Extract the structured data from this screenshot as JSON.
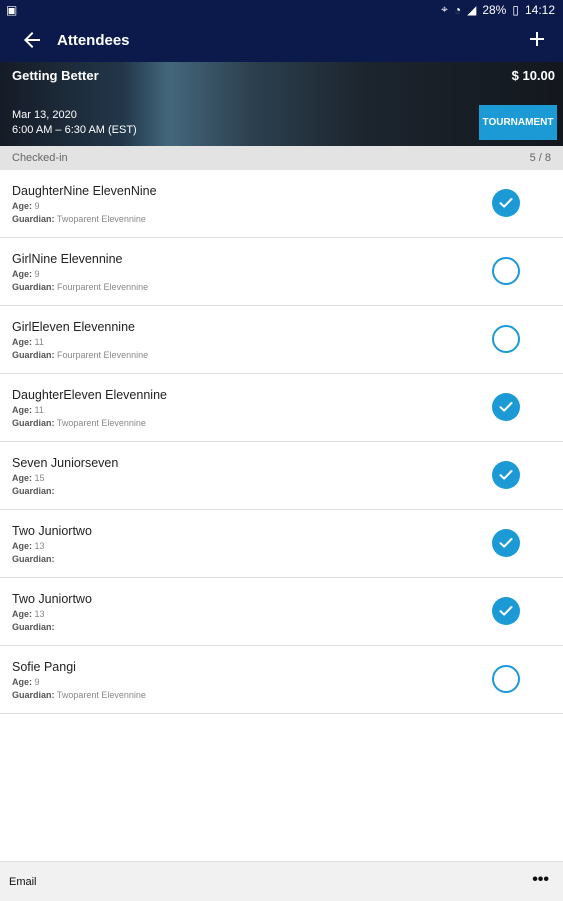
{
  "status_bar": {
    "time": "14:12",
    "battery": "28%"
  },
  "toolbar": {
    "title": "Attendees",
    "back_icon": "arrow-left-icon",
    "add_icon": "plus-icon"
  },
  "event": {
    "name": "Getting Better",
    "price": "$ 10.00",
    "date": "Mar 13, 2020",
    "time": "6:00 AM – 6:30 AM (EST)",
    "tag": "TOURNAMENT"
  },
  "section": {
    "label": "Checked-in",
    "count": "5 / 8"
  },
  "labels": {
    "age": "Age:",
    "guardian": "Guardian:"
  },
  "attendees": [
    {
      "name": "DaughterNine ElevenNine",
      "age": "9",
      "guardian": "Twoparent Elevennine",
      "checked": true
    },
    {
      "name": "GirlNine Elevennine",
      "age": "9",
      "guardian": "Fourparent Elevennine",
      "checked": false
    },
    {
      "name": "GirlEleven Elevennine",
      "age": "11",
      "guardian": "Fourparent Elevennine",
      "checked": false
    },
    {
      "name": "DaughterEleven Elevennine",
      "age": "11",
      "guardian": "Twoparent Elevennine",
      "checked": true
    },
    {
      "name": "Seven Juniorseven",
      "age": "15",
      "guardian": "",
      "checked": true
    },
    {
      "name": "Two Juniortwo",
      "age": "13",
      "guardian": "",
      "checked": true
    },
    {
      "name": "Two Juniortwo",
      "age": "13",
      "guardian": "",
      "checked": true
    },
    {
      "name": "Sofie Pangi",
      "age": "9",
      "guardian": "Twoparent Elevennine",
      "checked": false
    }
  ],
  "bottom_bar": {
    "email_label": "Email",
    "more_label": "•••"
  },
  "colors": {
    "header": "#0b1a4a",
    "accent": "#1b9ad6"
  }
}
